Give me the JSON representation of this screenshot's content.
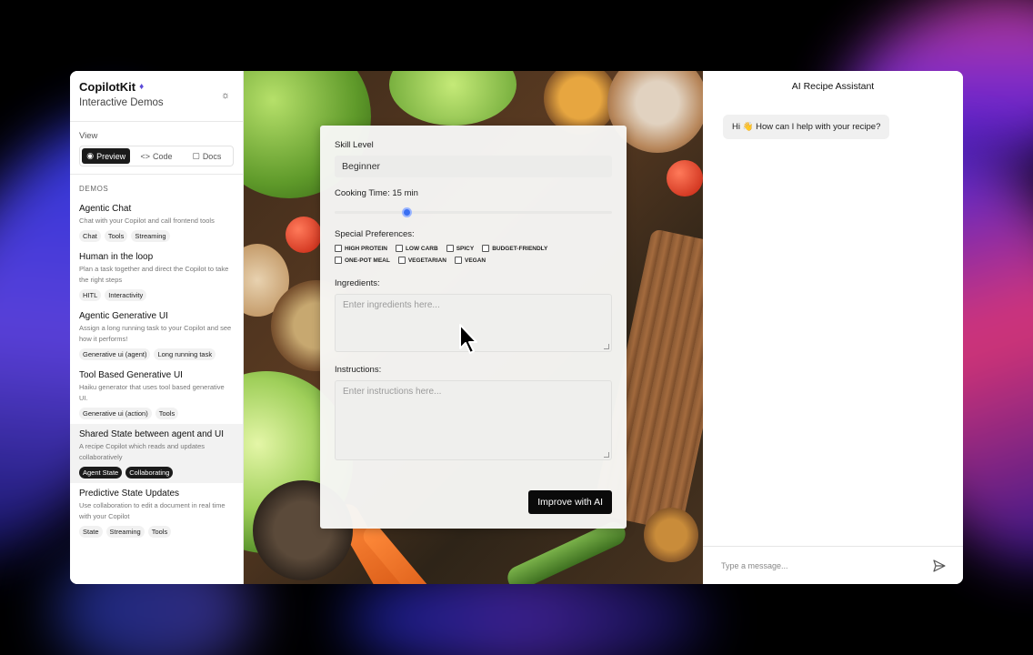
{
  "sidebar": {
    "brand_title": "CopilotKit",
    "brand_subtitle": "Interactive Demos",
    "view_label": "View",
    "view_options": [
      "Preview",
      "Code",
      "Docs"
    ],
    "demos_label": "DEMOS",
    "demos": [
      {
        "title": "Agentic Chat",
        "desc": "Chat with your Copilot and call frontend tools",
        "tags": [
          "Chat",
          "Tools",
          "Streaming"
        ]
      },
      {
        "title": "Human in the loop",
        "desc": "Plan a task together and direct the Copilot to take the right steps",
        "tags": [
          "HITL",
          "Interactivity"
        ]
      },
      {
        "title": "Agentic Generative UI",
        "desc": "Assign a long running task to your Copilot and see how it performs!",
        "tags": [
          "Generative ui (agent)",
          "Long running task"
        ]
      },
      {
        "title": "Tool Based Generative UI",
        "desc": "Haiku generator that uses tool based generative UI.",
        "tags": [
          "Generative ui (action)",
          "Tools"
        ]
      },
      {
        "title": "Shared State between agent and UI",
        "desc": "A recipe Copilot which reads and updates collaboratively",
        "tags": [
          "Agent State",
          "Collaborating"
        ]
      },
      {
        "title": "Predictive State Updates",
        "desc": "Use collaboration to edit a document in real time with your Copilot",
        "tags": [
          "State",
          "Streaming",
          "Tools"
        ]
      }
    ]
  },
  "form": {
    "skill_label": "Skill Level",
    "skill_value": "Beginner",
    "cooking_label": "Cooking Time: 15 min",
    "cooking_slider_fraction": 0.26,
    "prefs_label": "Special Preferences:",
    "preferences": [
      "HIGH PROTEIN",
      "LOW CARB",
      "SPICY",
      "BUDGET-FRIENDLY",
      "ONE-POT MEAL",
      "VEGETARIAN",
      "VEGAN"
    ],
    "ingredients_label": "Ingredients:",
    "ingredients_placeholder": "Enter ingredients here...",
    "instructions_label": "Instructions:",
    "instructions_placeholder": "Enter instructions here...",
    "improve_button": "Improve with AI"
  },
  "assistant": {
    "title": "AI Recipe Assistant",
    "greeting": "Hi 👋 How can I help with your recipe?",
    "input_placeholder": "Type a message..."
  },
  "colors": {
    "accent": "#3a6ff2",
    "button_dark": "#0a0a0a"
  }
}
